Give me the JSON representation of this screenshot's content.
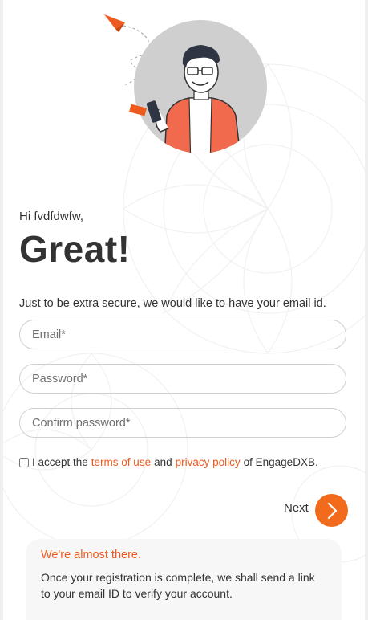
{
  "greeting": "Hi fvdfdwfw,",
  "headline": "Great!",
  "subtitle": "Just to be extra secure, we would like to have your email id.",
  "form": {
    "email_placeholder": "Email*",
    "password_placeholder": "Password*",
    "confirm_placeholder": "Confirm password*"
  },
  "terms": {
    "prefix": "I accept the",
    "terms_link": "terms of use",
    "and": "and",
    "privacy_link": "privacy policy",
    "suffix": "of EngageDXB.",
    "checked": false
  },
  "next": {
    "label": "Next",
    "icon": "chevron-right-icon"
  },
  "notice": {
    "title": "We're almost there.",
    "body": "Once your registration is complete, we shall send a link to your email ID to verify your account."
  },
  "colors": {
    "accent": "#f26a1b",
    "link": "#ee5a1e",
    "text": "#333333"
  }
}
